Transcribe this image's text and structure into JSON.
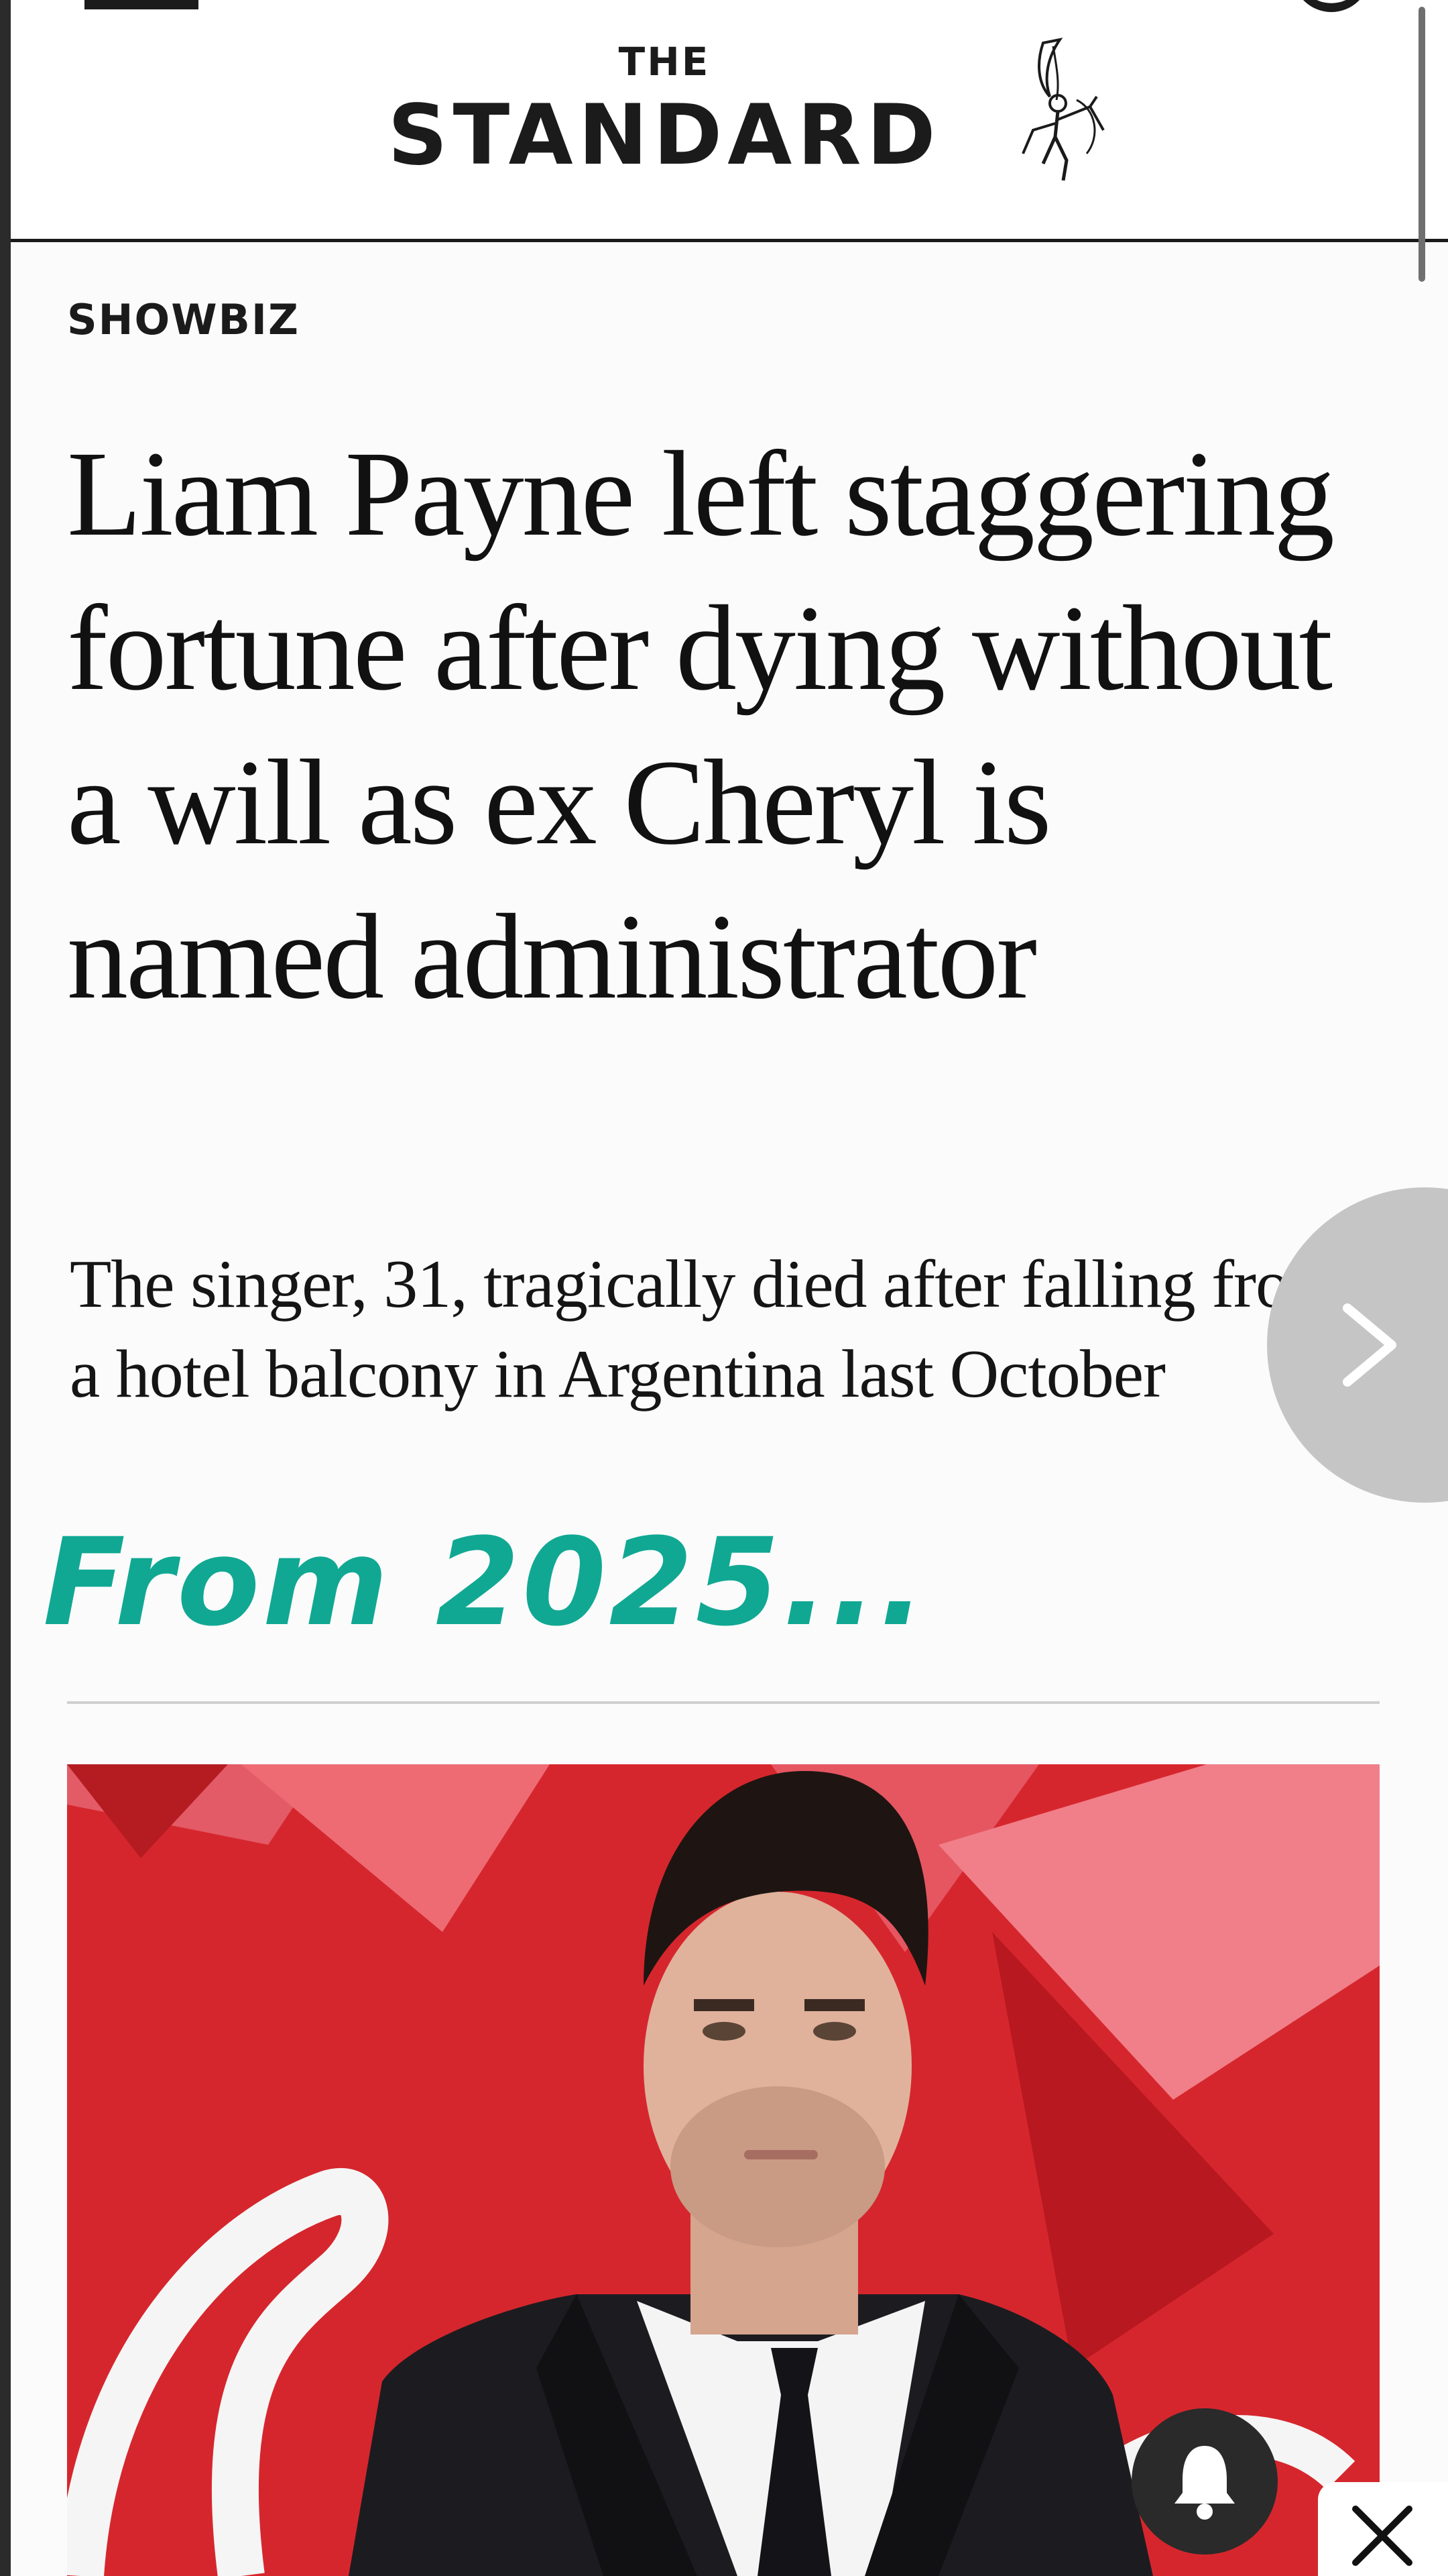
{
  "header": {
    "logo_top": "THE",
    "logo_main": "STANDARD"
  },
  "article": {
    "section": "SHOWBIZ",
    "headline": "Liam Payne left staggering fortune after dying without a will as ex Cheryl is named administrator",
    "subhead": "The singer, 31, tragically died after falling from a hotel balcony in Argentina last October"
  },
  "overlay": {
    "caption": "From 2025..."
  },
  "icons": {
    "menu": "hamburger-icon",
    "account": "account-icon",
    "logo_mark": "eros-icon",
    "next": "chevron-right-icon",
    "notifications": "bell-icon",
    "close": "close-icon"
  },
  "colors": {
    "accent_caption": "#10a893",
    "hero_background": "#d6262d",
    "text": "#111111"
  }
}
